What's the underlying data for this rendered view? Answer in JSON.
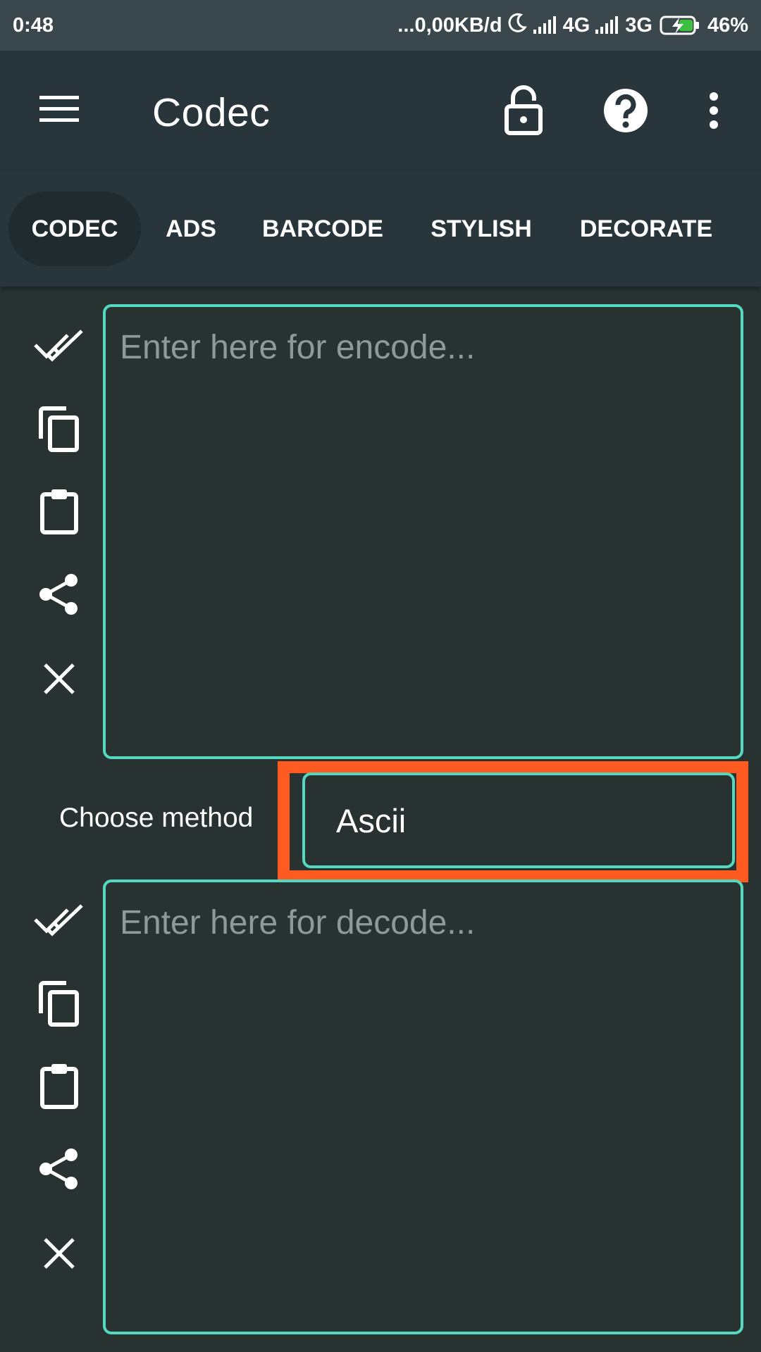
{
  "status_bar": {
    "time": "0:48",
    "speed": "...0,00KB/d",
    "network_1": "4G",
    "network_2": "3G",
    "battery": "46%"
  },
  "toolbar": {
    "title": "Codec",
    "icons": [
      "menu-icon",
      "lock-icon",
      "help-icon",
      "more-vert-icon"
    ]
  },
  "tabs": [
    {
      "label": "CODEC",
      "active": true
    },
    {
      "label": "ADS",
      "active": false
    },
    {
      "label": "BARCODE",
      "active": false
    },
    {
      "label": "STYLISH",
      "active": false
    },
    {
      "label": "DECORATE",
      "active": false
    }
  ],
  "encode": {
    "placeholder": "Enter here for encode...",
    "value": ""
  },
  "method": {
    "label": "Choose method",
    "selected": "Ascii"
  },
  "decode": {
    "placeholder": "Enter here for decode...",
    "value": ""
  },
  "side_actions": [
    "select-all-icon",
    "copy-icon",
    "paste-icon",
    "share-icon",
    "clear-icon"
  ],
  "colors": {
    "accent": "#55d8c0",
    "highlight": "#ff5a1f",
    "background": "#283230",
    "toolbar": "#28363b"
  }
}
